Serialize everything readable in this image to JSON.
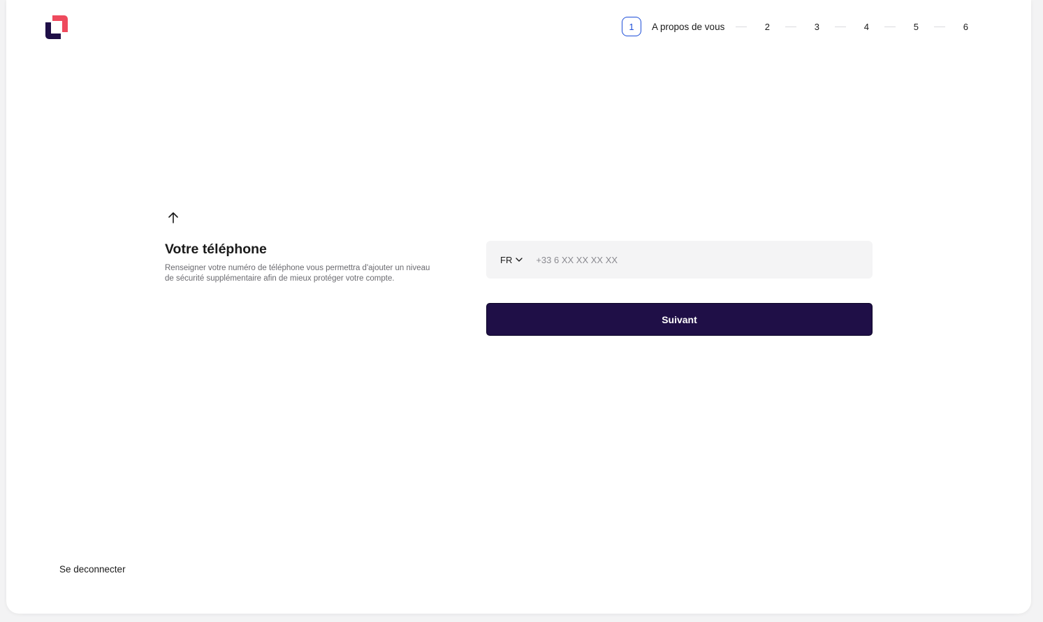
{
  "stepper": {
    "active_step": "1",
    "active_label": "A propos de vous",
    "steps": [
      "2",
      "3",
      "4",
      "5",
      "6"
    ]
  },
  "form": {
    "title": "Votre téléphone",
    "description": "Renseigner votre numéro de téléphone vous permettra d'ajouter un niveau de sécurité supplémentaire afin de mieux protéger votre compte.",
    "country_code": "FR",
    "phone_placeholder": "+33 6 XX XX XX XX",
    "phone_value": "",
    "submit_label": "Suivant"
  },
  "footer": {
    "logout_label": "Se deconnecter"
  },
  "colors": {
    "primary": "#1f0f47",
    "step_active": "#1d4ed8",
    "logo_red": "#ee4a5d",
    "logo_navy": "#1f0f47"
  },
  "icons": {
    "logo": "brand-logo-icon",
    "back": "arrow-up-icon",
    "dropdown": "chevron-down-icon"
  }
}
